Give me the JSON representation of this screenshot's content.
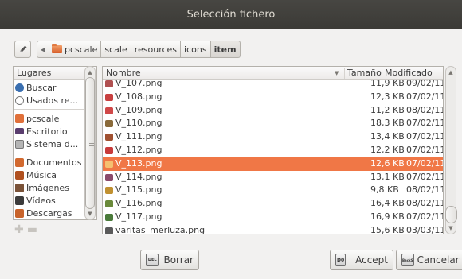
{
  "window": {
    "title": "Selección fichero"
  },
  "pathbar": {
    "crumbs": [
      "pcscale",
      "scale",
      "resources",
      "icons",
      "item"
    ]
  },
  "places": {
    "header": "Lugares",
    "items": [
      {
        "label": "Buscar",
        "icon": "search-icon",
        "color": "#3a6fb0"
      },
      {
        "label": "Usados re...",
        "icon": "clock-icon",
        "color": "#8a8a8a"
      },
      {
        "label": "pcscale",
        "icon": "folder-icon",
        "color": "#e0703a"
      },
      {
        "label": "Escritorio",
        "icon": "desktop-icon",
        "color": "#5a3d6e"
      },
      {
        "label": "Sistema d...",
        "icon": "drive-icon",
        "color": "#9a9a9a"
      },
      {
        "label": "Documentos",
        "icon": "documents-folder-icon",
        "color": "#d2692f"
      },
      {
        "label": "Música",
        "icon": "music-folder-icon",
        "color": "#b0501f"
      },
      {
        "label": "Imágenes",
        "icon": "pictures-folder-icon",
        "color": "#7a5238"
      },
      {
        "label": "Vídeos",
        "icon": "videos-folder-icon",
        "color": "#3b3b3b"
      },
      {
        "label": "Descargas",
        "icon": "downloads-folder-icon",
        "color": "#c8632b"
      }
    ]
  },
  "files": {
    "columns": {
      "name": "Nombre",
      "size": "Tamaño",
      "modified": "Modificado"
    },
    "rows": [
      {
        "name": "V_107.png",
        "size": "11,9 KB",
        "modified": "09/02/11",
        "color": "#b05050"
      },
      {
        "name": "V_108.png",
        "size": "12,3 KB",
        "modified": "07/02/11",
        "color": "#c84040"
      },
      {
        "name": "V_109.png",
        "size": "11,2 KB",
        "modified": "08/02/11",
        "color": "#d04848"
      },
      {
        "name": "V_110.png",
        "size": "18,3 KB",
        "modified": "07/02/11",
        "color": "#8a6a3a"
      },
      {
        "name": "V_111.png",
        "size": "13,4 KB",
        "modified": "07/02/11",
        "color": "#a05030"
      },
      {
        "name": "V_112.png",
        "size": "12,2 KB",
        "modified": "07/02/11",
        "color": "#c83a3a"
      },
      {
        "name": "V_113.png",
        "size": "12,6 KB",
        "modified": "07/02/11",
        "color": "#e8a050",
        "selected": true
      },
      {
        "name": "V_114.png",
        "size": "13,1 KB",
        "modified": "07/02/11",
        "color": "#8a4a6a"
      },
      {
        "name": "V_115.png",
        "size": "9,8 KB",
        "modified": "08/02/11",
        "color": "#c09030"
      },
      {
        "name": "V_116.png",
        "size": "16,4 KB",
        "modified": "08/02/11",
        "color": "#6a8a3a"
      },
      {
        "name": "V_117.png",
        "size": "16,9 KB",
        "modified": "07/02/11",
        "color": "#4a7a3a"
      },
      {
        "name": "varitas_merluza.png",
        "size": "15,6 KB",
        "modified": "03/03/11",
        "color": "#5a5a5a"
      }
    ]
  },
  "buttons": {
    "delete": {
      "label": "Borrar",
      "key": "DEL"
    },
    "accept": {
      "label": "Accept",
      "key": "D0"
    },
    "cancel": {
      "label": "Cancelar",
      "key": "BackS"
    }
  },
  "colors": {
    "selection": "#f07746",
    "titlebar": "#3c3b37"
  }
}
